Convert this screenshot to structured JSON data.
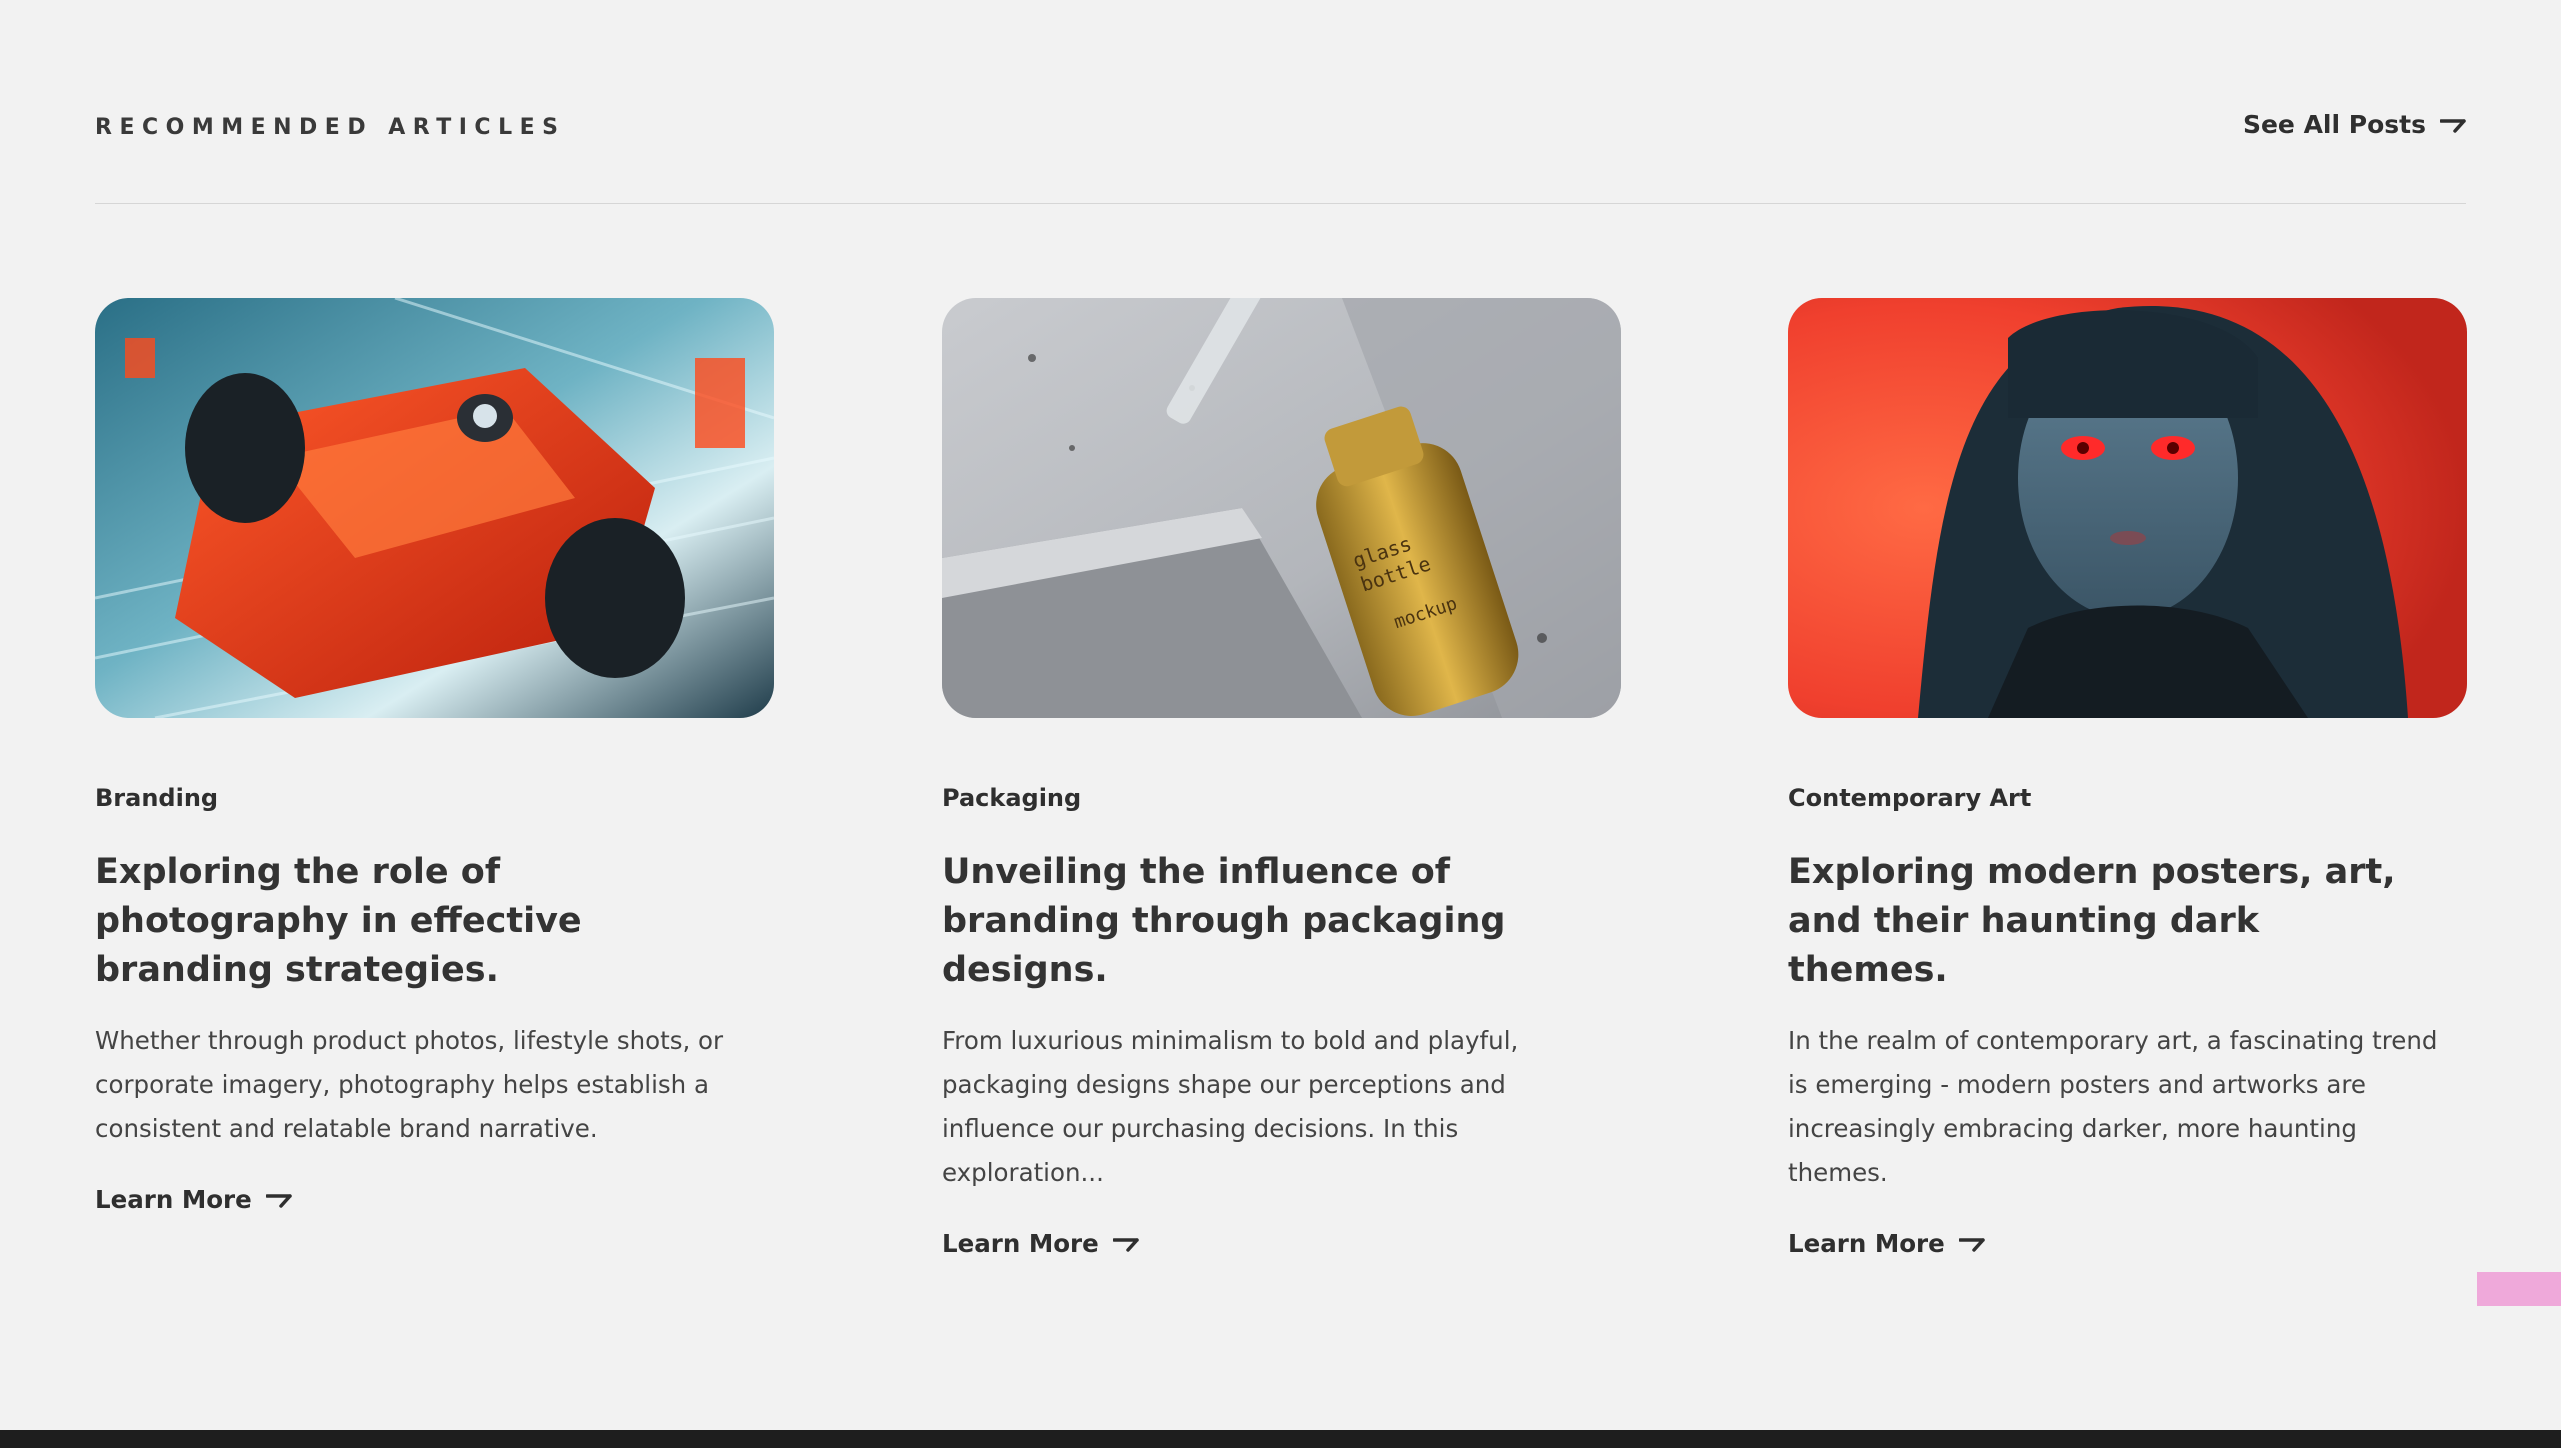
{
  "section": {
    "label": "RECOMMENDED ARTICLES",
    "see_all": "See All Posts"
  },
  "articles": [
    {
      "image_alt": "Red formula one race car speeding",
      "category": "Branding",
      "title": "Exploring the role of photography in effective branding strategies.",
      "excerpt": "Whether through product photos, lifestyle shots, or corporate imagery, photography helps establish a consistent and relatable brand narrative.",
      "cta": "Learn More"
    },
    {
      "image_alt": "Glass dropper bottle on concrete",
      "category": "Packaging",
      "title": "Unveiling the influence of branding through packaging designs.",
      "excerpt": "From luxurious minimalism to bold and playful, packaging designs shape our perceptions and influence our purchasing decisions. In this exploration...",
      "cta": "Learn More"
    },
    {
      "image_alt": "Dark portrait artwork with red background",
      "category": "Contemporary Art",
      "title": "Exploring modern posters, art, and their haunting dark themes.",
      "excerpt": "In the realm of contemporary art, a fascinating trend is emerging - modern posters and artworks are increasingly embracing darker, more haunting themes.",
      "cta": "Learn More"
    }
  ],
  "bottle_label": {
    "line1": "glass",
    "line2": "bottle",
    "line3": "mockup"
  },
  "colors": {
    "background": "#f2f2f2",
    "text": "#333333",
    "accent_pink": "#efa9da",
    "footer": "#1e1e1e"
  }
}
